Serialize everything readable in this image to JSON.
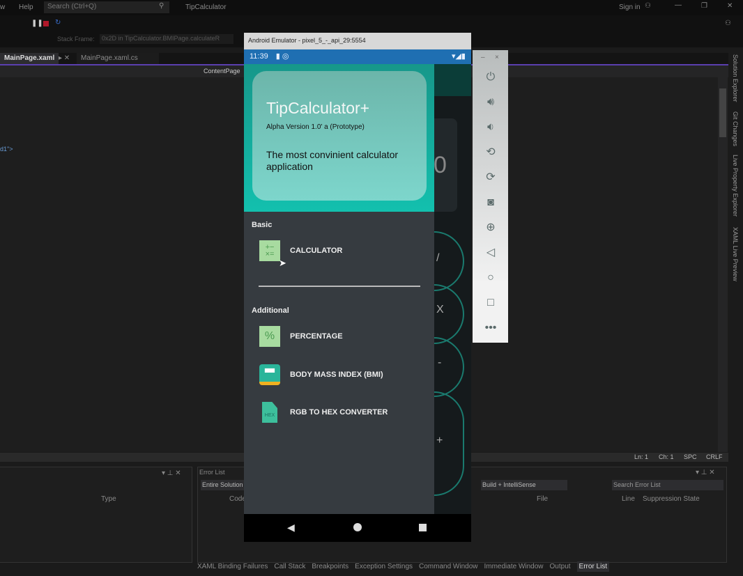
{
  "vs": {
    "menu": [
      "w",
      "Help"
    ],
    "search_placeholder": "Search (Ctrl+Q)",
    "solution_title": "TipCalculator",
    "sign_in": "Sign in",
    "stack_frame_label": "Stack Frame:",
    "stack_frame_value": "0x2D in TipCalculator.BMIPage.calculateR",
    "tabs": [
      {
        "label": "MainPage.xaml",
        "active": true
      },
      {
        "label": "MainPage.xaml.cs",
        "active": false
      }
    ],
    "nav_dropdown": "ContentPage",
    "code_fragment": "d1\">",
    "status": {
      "ln": "Ln: 1",
      "ch": "Ch: 1",
      "spc": "SPC",
      "crlf": "CRLF"
    },
    "left_panel": {
      "col_type": "Type"
    },
    "error_list": {
      "title": "Error List",
      "scope": "Entire Solution",
      "build_filter": "Build + IntelliSense",
      "search_placeholder": "Search Error List",
      "columns": [
        "Code",
        "File",
        "Line",
        "Suppression State"
      ]
    },
    "bottom_tabs": [
      "XAML Binding Failures",
      "Call Stack",
      "Breakpoints",
      "Exception Settings",
      "Command Window",
      "Immediate Window",
      "Output",
      "Error List"
    ],
    "right_tabs": [
      "Solution Explorer",
      "Git Changes",
      "Live Property Explorer",
      "XAML Live Preview"
    ]
  },
  "emulator": {
    "title": "Android Emulator - pixel_5_-_api_29:5554",
    "time": "11:39",
    "header": {
      "title": "TipCalculator+",
      "version": "Alpha Version 1.0' a (Prototype)",
      "tagline": "The most convinient calculator application"
    },
    "sections": [
      {
        "label": "Basic",
        "items": [
          {
            "label": "CALCULATOR",
            "icon": "calculator-icon"
          }
        ]
      },
      {
        "label": "Additional",
        "items": [
          {
            "label": "PERCENTAGE",
            "icon": "percent-icon"
          },
          {
            "label": "BODY MASS INDEX (BMI)",
            "icon": "scale-icon"
          },
          {
            "label": "RGB TO HEX CONVERTER",
            "icon": "hex-file-icon"
          }
        ]
      }
    ],
    "background_app": {
      "display": "0",
      "buttons": [
        "/",
        "X",
        "-",
        "+"
      ]
    },
    "hex_label": "HEX"
  },
  "colors": {
    "accent": "#5b3fb0",
    "teal": "#13c0ae",
    "statusbar": "#1f6fb2"
  }
}
